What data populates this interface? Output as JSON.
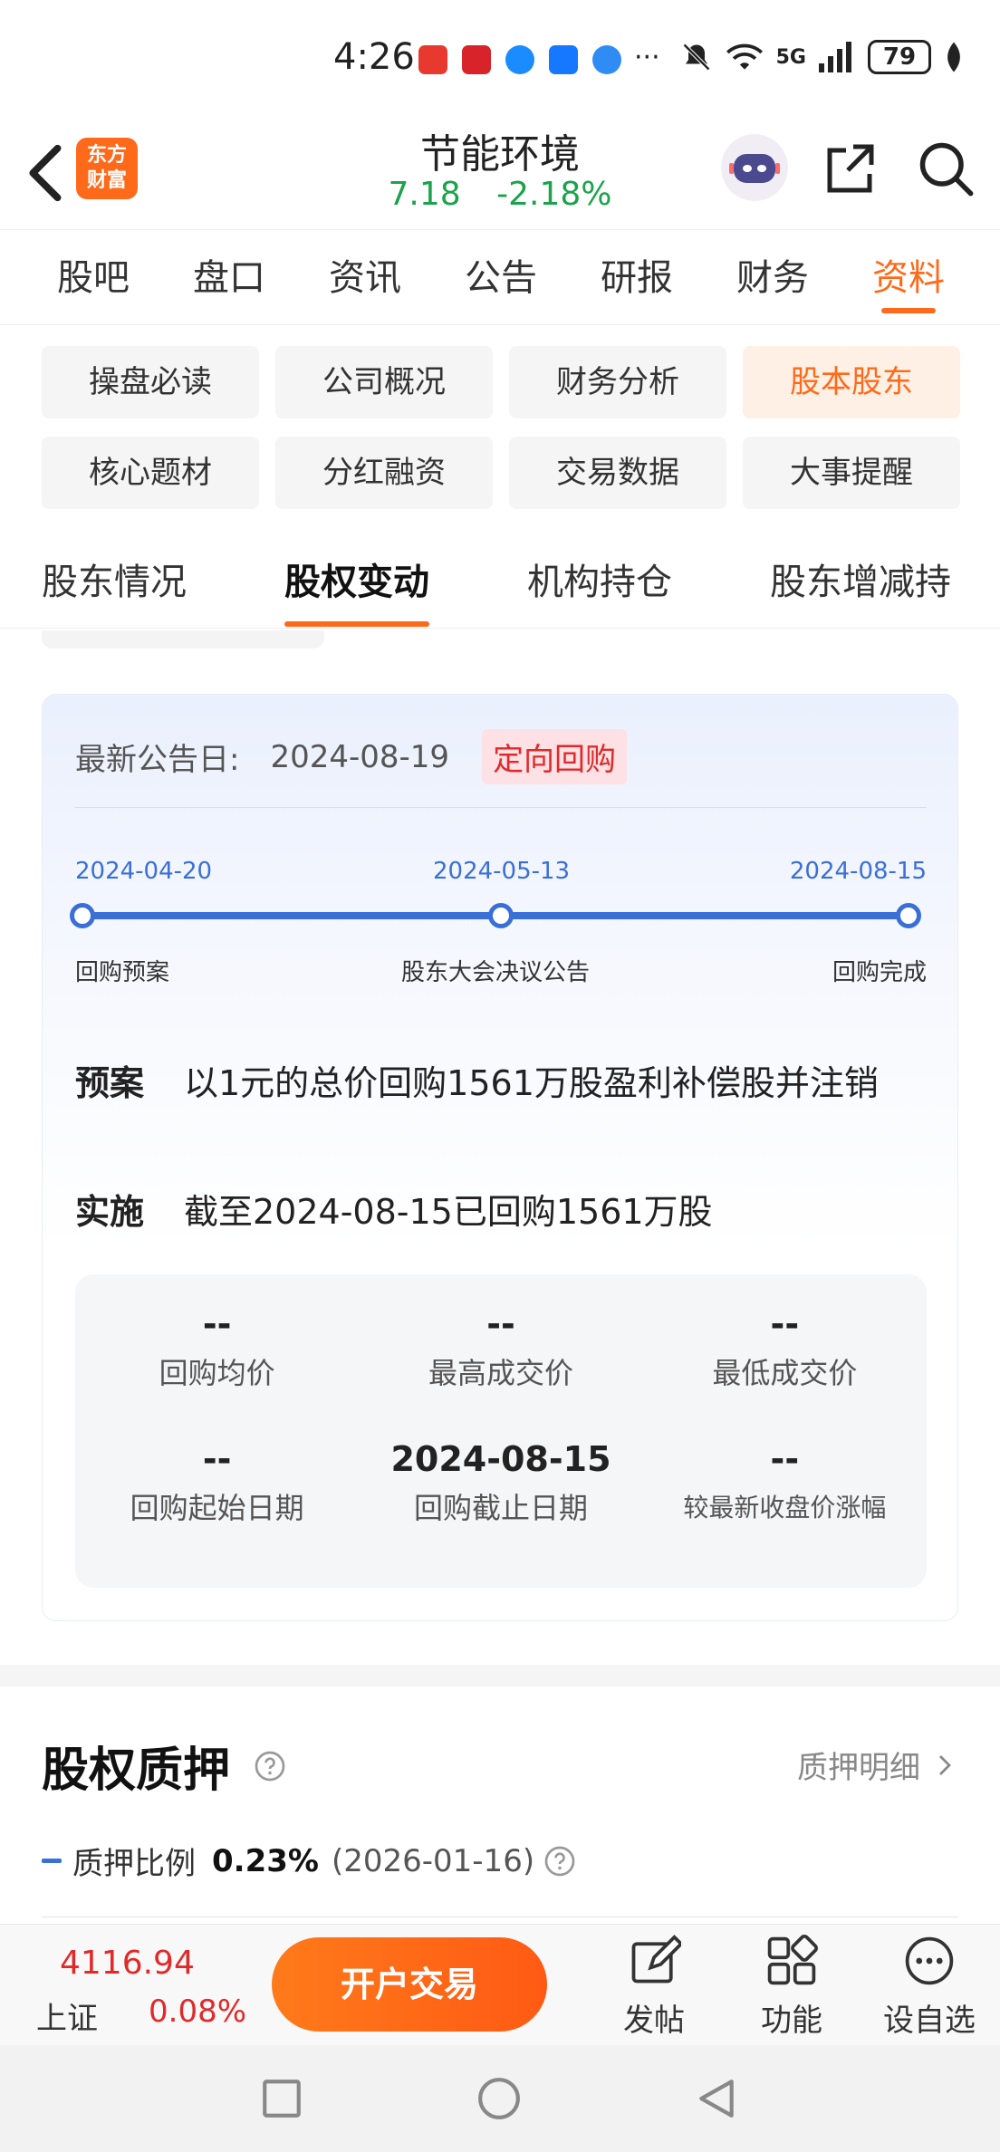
{
  "status_bar": {
    "time": "4:26",
    "network": "5G",
    "battery": "79",
    "more": "···"
  },
  "header": {
    "logo_text_line1": "东方",
    "logo_text_line2": "财富",
    "stock_name": "节能环境",
    "price": "7.18",
    "change_pct": "-2.18%",
    "down_color": "#1aa34a"
  },
  "main_tabs": [
    {
      "label": "股吧"
    },
    {
      "label": "盘口"
    },
    {
      "label": "资讯"
    },
    {
      "label": "公告"
    },
    {
      "label": "研报"
    },
    {
      "label": "财务"
    },
    {
      "label": "资料",
      "active": true
    }
  ],
  "sub_tabs": [
    {
      "label": "操盘必读"
    },
    {
      "label": "公司概况"
    },
    {
      "label": "财务分析"
    },
    {
      "label": "股本股东",
      "active": true
    },
    {
      "label": "核心题材"
    },
    {
      "label": "分红融资"
    },
    {
      "label": "交易数据"
    },
    {
      "label": "大事提醒"
    }
  ],
  "section_tabs": [
    {
      "label": "股东情况"
    },
    {
      "label": "股权变动",
      "active": true
    },
    {
      "label": "机构持仓"
    },
    {
      "label": "股东增减持"
    }
  ],
  "buyback": {
    "announce_label": "最新公告日:",
    "announce_date": "2024-08-19",
    "badge": "定向回购",
    "timeline": [
      {
        "date": "2024-04-20",
        "label": "回购预案"
      },
      {
        "date": "2024-05-13",
        "label": "股东大会决议公告"
      },
      {
        "date": "2024-08-15",
        "label": "回购完成"
      }
    ],
    "plan_key": "预案",
    "plan_value": "以1元的总价回购1561万股盈利补偿股并注销",
    "impl_key": "实施",
    "impl_value": "截至2024-08-15已回购1561万股",
    "stats": [
      {
        "value": "--",
        "label": "回购均价"
      },
      {
        "value": "--",
        "label": "最高成交价"
      },
      {
        "value": "--",
        "label": "最低成交价"
      },
      {
        "value": "--",
        "label": "回购起始日期"
      },
      {
        "value": "2024-08-15",
        "label": "回购截止日期"
      },
      {
        "value": "--",
        "label": "较最新收盘价涨幅"
      }
    ]
  },
  "pledge": {
    "title": "股权质押",
    "detail_link": "质押明细",
    "ratio_label": "质押比例",
    "ratio_value": "0.23%",
    "ratio_date": "(2026-01-16)"
  },
  "bottom_bar": {
    "index_value": "4116.94",
    "index_name": "上证",
    "index_change": "0.08%",
    "trade_button": "开户交易",
    "post_label": "发帖",
    "func_label": "功能",
    "watch_label": "设自选"
  },
  "accent_color": "#ff6a1a",
  "up_color": "#e02a2a"
}
